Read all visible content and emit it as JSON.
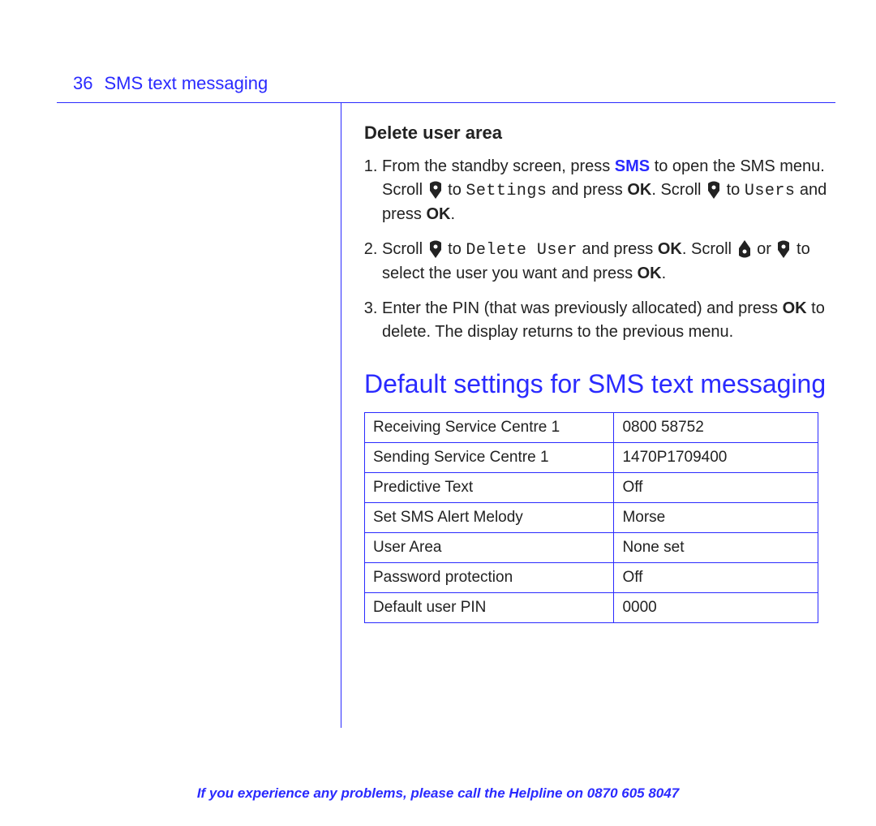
{
  "header": {
    "page_number": "36",
    "chapter": "SMS text messaging"
  },
  "section": {
    "title": "Delete user area",
    "steps": {
      "s1": {
        "t1": "From the standby screen, press ",
        "sms": "SMS",
        "t2": " to open the SMS menu. Scroll ",
        "t3": " to ",
        "settings_lcd": "Settings",
        "t4": " and press ",
        "ok1": "OK",
        "t5": ". Scroll ",
        "t6": " to ",
        "users_lcd": "Users",
        "t7": " and press ",
        "ok2": "OK",
        "t8": "."
      },
      "s2": {
        "t1": "Scroll ",
        "t2": " to ",
        "delete_lcd": "Delete User",
        "t3": " and press ",
        "ok1": "OK",
        "t4": ". Scroll ",
        "t5": " or ",
        "t6": " to select the user you want and press ",
        "ok2": "OK",
        "t7": "."
      },
      "s3": {
        "t1": "Enter the PIN (that was previously allocated) and press ",
        "ok": "OK",
        "t2": " to delete. The display returns to the previous menu."
      }
    }
  },
  "main_title": "Default settings for SMS text messaging",
  "table": {
    "rows": [
      {
        "label": "Receiving Service Centre 1",
        "value": "0800 58752"
      },
      {
        "label": "Sending Service Centre 1",
        "value": "1470P1709400"
      },
      {
        "label": "Predictive Text",
        "value": "Off"
      },
      {
        "label": "Set SMS Alert Melody",
        "value": "Morse"
      },
      {
        "label": "User Area",
        "value": "None set"
      },
      {
        "label": "Password protection",
        "value": "Off"
      },
      {
        "label": "Default user PIN",
        "value": "0000"
      }
    ]
  },
  "footer": {
    "text": "If you experience any problems, please call the Helpline on ",
    "phone": "0870 605 8047"
  }
}
